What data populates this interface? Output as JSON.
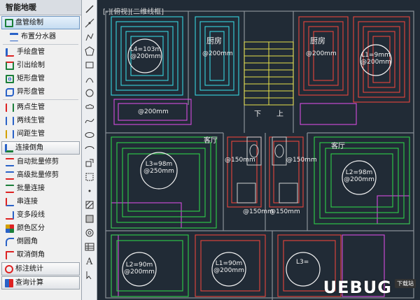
{
  "panel": {
    "title": "智能地暖",
    "sections": [
      {
        "header": "盘管绘制",
        "active": true,
        "icon": "coil-icon",
        "items": [
          "布置分水器"
        ]
      },
      {
        "items": [
          "手绘盘管",
          "引出绘制",
          "矩形盘管",
          "异形盘管"
        ]
      },
      {
        "items": [
          "两点生管",
          "两线生管",
          "间距生管"
        ]
      },
      {
        "header": "连接倒角",
        "icon": "connect-icon",
        "items": [
          "自动批量修剪",
          "高级批量修剪",
          "批量连接",
          "串连接",
          "变多段线",
          "颜色区分",
          "倒圆角",
          "取消倒角"
        ]
      },
      {
        "header": "标注统计",
        "icon": "target-icon",
        "items": []
      },
      {
        "header": "查询计算",
        "icon": "calc-icon",
        "items": []
      }
    ]
  },
  "canvas": {
    "view_label": "[-][俯视][二维线框]",
    "rooms": [
      {
        "label": "L4=103m",
        "spacing": "@200mm"
      },
      {
        "label": "L1=9mm",
        "spacing": "@200mm"
      },
      {
        "label": "L3=98m",
        "spacing": "@250mm"
      },
      {
        "label": "L2=98m",
        "spacing": "@200mm"
      },
      {
        "label": "L1=90m",
        "spacing": "@200mm"
      },
      {
        "label": "L2=90m",
        "spacing": "@200mm"
      }
    ],
    "texts": {
      "kitchen1": "厨房",
      "kitchen2": "厨房",
      "living1": "客厅",
      "living2": "客厅",
      "down": "下",
      "up": "上",
      "spacing_a": "@200mm",
      "spacing_b": "@200mm",
      "spacing_c": "@150mm",
      "spacing_d": "@150mm",
      "spacing_e": "@150mm",
      "spacing_f": "@150mm",
      "spacing_g": "@200mm",
      "room_l3": "L3="
    }
  },
  "watermark": {
    "logo": "UEBUG",
    "sub": "下载站"
  },
  "colors": {
    "cyan": "#38d6e0",
    "red": "#e8453c",
    "green": "#2fd04a",
    "magenta": "#d64de0",
    "white": "#f2f2f2",
    "yellow": "#e8e04a",
    "canvas_bg": "#212b36"
  }
}
